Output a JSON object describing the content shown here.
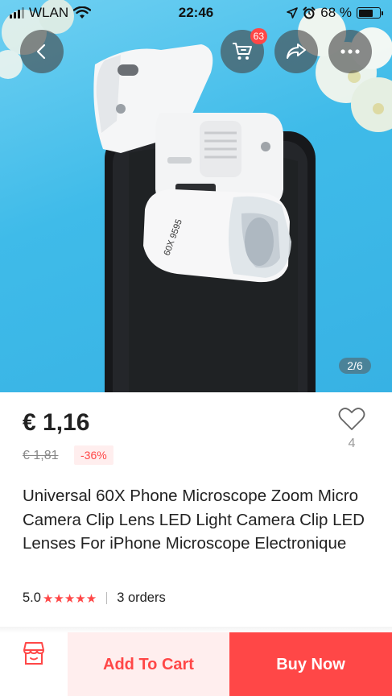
{
  "status_bar": {
    "carrier": "WLAN",
    "time": "22:46",
    "battery_percent": "68 %",
    "battery_level": 0.68
  },
  "gallery": {
    "counter": "2/6",
    "cart_badge": "63"
  },
  "product": {
    "price": "€ 1,16",
    "original_price": "€ 1,81",
    "discount": "-36%",
    "wishlist_count": "4",
    "title": "Universal 60X Phone Microscope Zoom Micro Camera Clip Lens LED Light Camera Clip LED Lenses For iPhone Microscope Electronique",
    "rating": "5.0",
    "stars": "★★★★★",
    "orders": "3 orders",
    "lens_print": "60X 9595"
  },
  "actions": {
    "add_to_cart": "Add To Cart",
    "buy_now": "Buy Now"
  },
  "icons": {
    "back": "chevron-left-icon",
    "cart": "cart-icon",
    "share": "share-icon",
    "more": "more-icon",
    "wishlist": "heart-icon",
    "store": "store-icon"
  },
  "colors": {
    "accent": "#ff4747",
    "accent_light": "#ffeeee",
    "sky": "#3fbbe9"
  }
}
